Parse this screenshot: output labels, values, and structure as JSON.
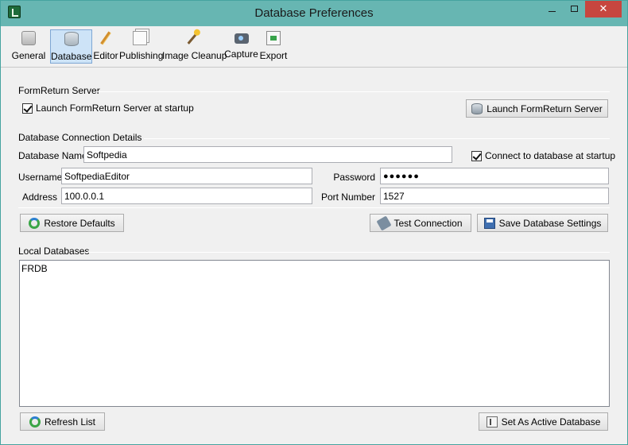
{
  "window": {
    "title": "Database Preferences",
    "minimize_label": "",
    "maximize_label": "",
    "close_label": "✕"
  },
  "toolbar": {
    "items": [
      {
        "label": "General",
        "icon": "general-icon"
      },
      {
        "label": "Database",
        "icon": "database-icon"
      },
      {
        "label": "Editor",
        "icon": "editor-icon"
      },
      {
        "label": "Publishing",
        "icon": "publishing-icon"
      },
      {
        "label": "Image Cleanup",
        "icon": "image-cleanup-icon"
      },
      {
        "label": "Capture",
        "icon": "capture-icon"
      },
      {
        "label": "Export",
        "icon": "export-icon"
      }
    ],
    "active": "Database"
  },
  "server": {
    "section_title": "FormReturn Server",
    "launch_at_startup_label": "Launch FormReturn Server at startup",
    "launch_at_startup_checked": true,
    "launch_button": "Launch FormReturn Server"
  },
  "connection": {
    "section_title": "Database Connection Details",
    "database_name_label": "Database Name",
    "database_name_value": "Softpedia",
    "connect_at_startup_label": "Connect to database at startup",
    "connect_at_startup_checked": true,
    "username_label": "Username",
    "username_value": "SoftpediaEditor",
    "password_label": "Password",
    "password_value": "●●●●●●",
    "address_label": "Address",
    "address_value": "100.0.0.1",
    "port_label": "Port Number",
    "port_value": "1527"
  },
  "actions": {
    "restore_defaults": "Restore Defaults",
    "test_connection": "Test Connection",
    "save_settings": "Save Database Settings"
  },
  "local_databases": {
    "section_title": "Local Databases",
    "items": [
      "FRDB"
    ],
    "refresh_button": "Refresh List",
    "set_active_button": "Set As Active Database"
  },
  "colors": {
    "titlebar": "#67b6b2",
    "close_button": "#c7463f",
    "active_tab": "#cde3f7"
  }
}
